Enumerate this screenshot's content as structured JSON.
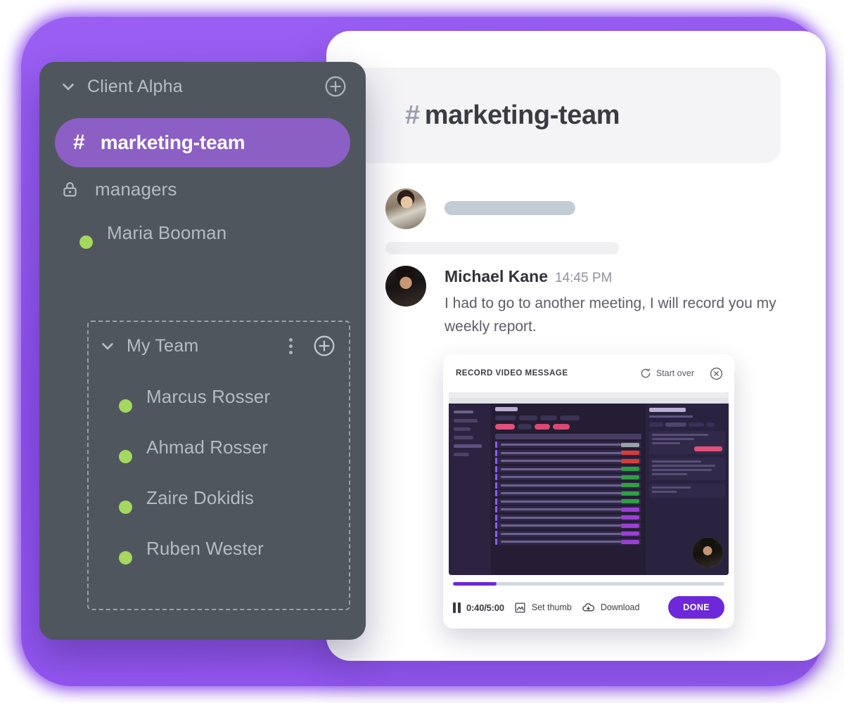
{
  "theme": {
    "accent_purple": "#8b5fc4",
    "backdrop_purple": "#9455f0",
    "button_purple": "#6d28d9",
    "sidebar_bg": "#50565e",
    "online_green": "#a5d85f"
  },
  "sidebar": {
    "client_section": {
      "title": "Client Alpha",
      "collapse_icon": "chevron-down-icon",
      "add_icon": "plus-circle-icon",
      "items": [
        {
          "label": "marketing-team",
          "type": "channel",
          "icon": "hash-icon",
          "active": true
        },
        {
          "label": "managers",
          "type": "private-channel",
          "icon": "lock-icon",
          "active": false
        },
        {
          "label": "Maria Booman",
          "type": "person",
          "icon": "avatar",
          "status": "online"
        }
      ]
    },
    "team_section": {
      "title": "My Team",
      "collapse_icon": "chevron-down-icon",
      "more_icon": "kebab-menu-icon",
      "add_icon": "plus-circle-icon",
      "members": [
        {
          "label": "Marcus Rosser",
          "status": "online"
        },
        {
          "label": "Ahmad Rosser",
          "status": "online"
        },
        {
          "label": "Zaire Dokidis",
          "status": "online"
        },
        {
          "label": "Ruben Wester",
          "status": "online"
        }
      ]
    }
  },
  "main": {
    "channel_header": {
      "hash": "#",
      "title": "marketing-team"
    },
    "messages": [
      {
        "type": "skeleton",
        "author": "",
        "time": "",
        "text": ""
      },
      {
        "type": "text",
        "author": "Michael Kane",
        "time": "14:45 PM",
        "text": "I had to go to another meeting, I will record you my weekly report."
      }
    ]
  },
  "recorder": {
    "header": {
      "title": "RECORD VIDEO MESSAGE",
      "start_over_label": "Start over",
      "start_over_icon": "refresh-icon",
      "close_icon": "close-circle-icon"
    },
    "progress": {
      "percent": 16
    },
    "controls": {
      "pause_icon": "pause-icon",
      "time_label": "0:40/5:00",
      "set_thumb_label": "Set thumb",
      "set_thumb_icon": "image-icon",
      "download_label": "Download",
      "download_icon": "cloud-download-icon",
      "done_label": "DONE"
    },
    "preview": {
      "description": "blurred screen recording of a dark project management board with a circular webcam overlay",
      "task_status_colors": [
        "#9aa0a8",
        "#d93b3b",
        "#d93b3b",
        "#2f9e44",
        "#2f9e44",
        "#2f9e44",
        "#2f9e44",
        "#2f9e44",
        "#9b3fd4",
        "#9b3fd4",
        "#9b3fd4",
        "#9b3fd4",
        "#9b3fd4"
      ],
      "webcam_overlay": true
    }
  }
}
